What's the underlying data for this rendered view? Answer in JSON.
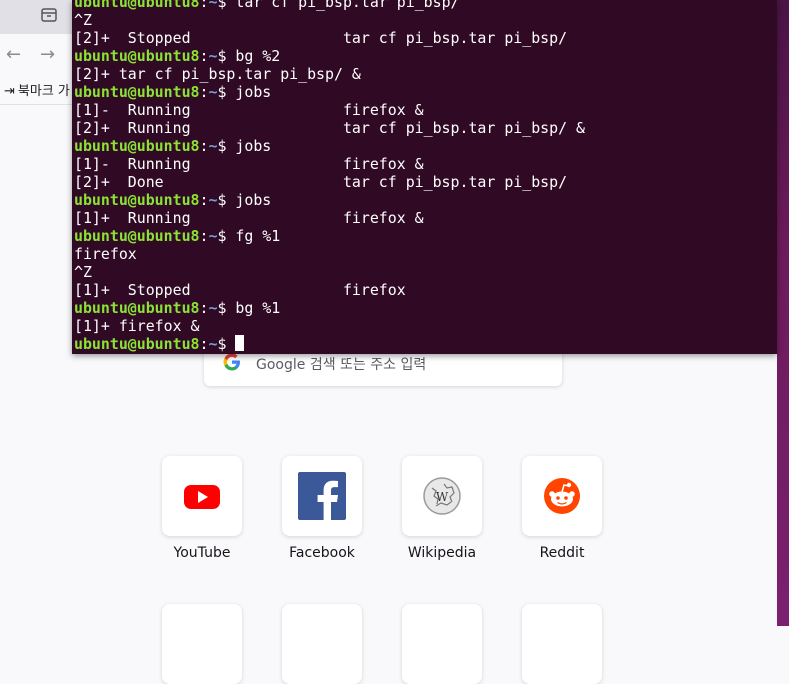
{
  "browser": {
    "bookmarks_label": "북마크 가"
  },
  "newtab": {
    "search_placeholder": "Google 검색 또는 주소 입력",
    "shortcuts": [
      {
        "label": "YouTube",
        "icon": "youtube-icon",
        "color": "#ff0000"
      },
      {
        "label": "Facebook",
        "icon": "facebook-icon",
        "color": "#3b5998"
      },
      {
        "label": "Wikipedia",
        "icon": "wikipedia-icon",
        "color": "#888888"
      },
      {
        "label": "Reddit",
        "icon": "reddit-icon",
        "color": "#ff4500"
      }
    ]
  },
  "terminal": {
    "bg_color": "#300a24",
    "prompt_user": "ubuntu@ubuntu8",
    "prompt_sep": ":",
    "prompt_path": "~",
    "prompt_symbol": "$ ",
    "lines": [
      {
        "prompt": true,
        "text": "tar cf pi_bsp.tar pi_bsp/"
      },
      {
        "prompt": false,
        "text": "^Z"
      },
      {
        "prompt": false,
        "text": "[2]+  Stopped                 tar cf pi_bsp.tar pi_bsp/"
      },
      {
        "prompt": true,
        "text": "bg %2"
      },
      {
        "prompt": false,
        "text": "[2]+ tar cf pi_bsp.tar pi_bsp/ &"
      },
      {
        "prompt": true,
        "text": "jobs"
      },
      {
        "prompt": false,
        "text": "[1]-  Running                 firefox &"
      },
      {
        "prompt": false,
        "text": "[2]+  Running                 tar cf pi_bsp.tar pi_bsp/ &"
      },
      {
        "prompt": true,
        "text": "jobs"
      },
      {
        "prompt": false,
        "text": "[1]-  Running                 firefox &"
      },
      {
        "prompt": false,
        "text": "[2]+  Done                    tar cf pi_bsp.tar pi_bsp/"
      },
      {
        "prompt": true,
        "text": "jobs"
      },
      {
        "prompt": false,
        "text": "[1]+  Running                 firefox &"
      },
      {
        "prompt": true,
        "text": "fg %1"
      },
      {
        "prompt": false,
        "text": "firefox"
      },
      {
        "prompt": false,
        "text": "^Z"
      },
      {
        "prompt": false,
        "text": "[1]+  Stopped                 firefox"
      },
      {
        "prompt": true,
        "text": "bg %1"
      },
      {
        "prompt": false,
        "text": "[1]+ firefox &"
      },
      {
        "prompt": true,
        "text": "",
        "cursor": true
      }
    ]
  }
}
